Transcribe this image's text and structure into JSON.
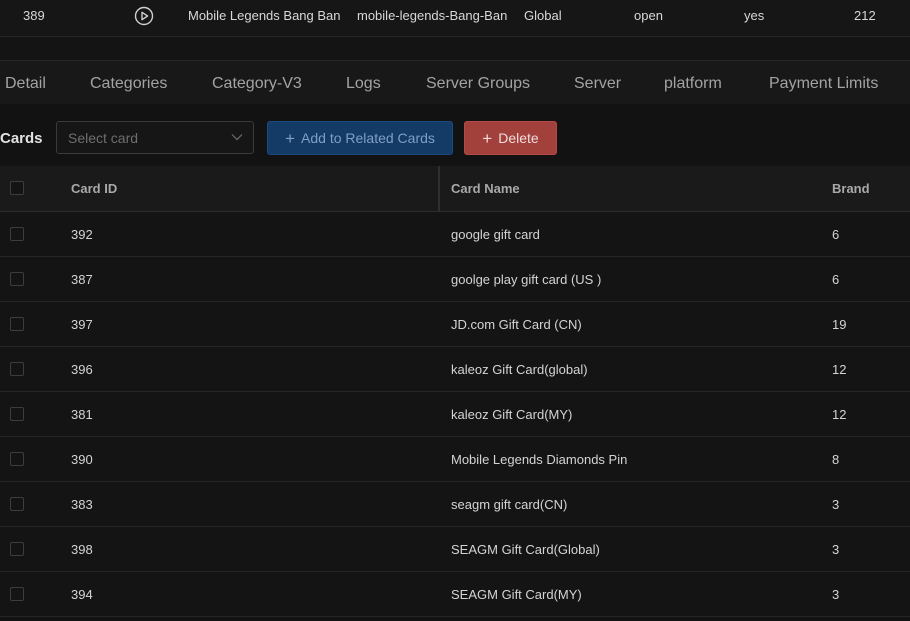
{
  "top_row": {
    "id": "389",
    "icon": "play-circle-icon",
    "name": "Mobile Legends Bang Ban",
    "slug": "mobile-legends-Bang-Ban",
    "region": "Global",
    "status": "open",
    "flag": "yes",
    "count": "212"
  },
  "tabs": [
    "Detail",
    "Categories",
    "Category-V3",
    "Logs",
    "Server Groups",
    "Server",
    "platform",
    "Payment Limits"
  ],
  "toolbar": {
    "label": "Cards",
    "select_placeholder": "Select card",
    "add_label": "Add to Related Cards",
    "delete_label": "Delete"
  },
  "table": {
    "headers": {
      "card_id": "Card ID",
      "card_name": "Card Name",
      "brand": "Brand"
    },
    "rows": [
      {
        "id": "392",
        "name": "google gift card",
        "brand": "6"
      },
      {
        "id": "387",
        "name": "goolge play gift card (US )",
        "brand": "6"
      },
      {
        "id": "397",
        "name": "JD.com Gift Card (CN)",
        "brand": "19"
      },
      {
        "id": "396",
        "name": "kaleoz Gift Card(global)",
        "brand": "12"
      },
      {
        "id": "381",
        "name": "kaleoz Gift Card(MY)",
        "brand": "12"
      },
      {
        "id": "390",
        "name": "Mobile Legends Diamonds Pin",
        "brand": "8"
      },
      {
        "id": "383",
        "name": "seagm gift card(CN)",
        "brand": "3"
      },
      {
        "id": "398",
        "name": "SEAGM Gift Card(Global)",
        "brand": "3"
      },
      {
        "id": "394",
        "name": "SEAGM Gift Card(MY)",
        "brand": "3"
      }
    ]
  },
  "colors": {
    "add_button": "#143a66",
    "delete_button": "#a2403c",
    "background": "#131313"
  }
}
